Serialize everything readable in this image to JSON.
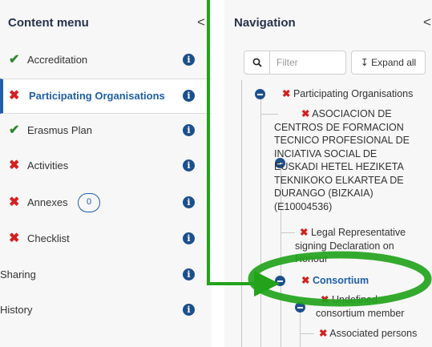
{
  "content_menu": {
    "title": "Content menu",
    "collapse_glyph": "<",
    "items": [
      {
        "label": "Accreditation",
        "status": "complete",
        "status_glyph": "✔",
        "info_glyph": "i"
      },
      {
        "label": "Participating Organisations",
        "status": "error",
        "status_glyph": "✖",
        "info_glyph": "i",
        "active": true
      },
      {
        "label": "Erasmus Plan",
        "status": "complete",
        "status_glyph": "✔",
        "info_glyph": "i"
      },
      {
        "label": "Activities",
        "status": "error",
        "status_glyph": "✖",
        "info_glyph": "i"
      },
      {
        "label": "Annexes",
        "status": "error",
        "status_glyph": "✖",
        "info_glyph": "i",
        "badge": "0"
      },
      {
        "label": "Checklist",
        "status": "error",
        "status_glyph": "✖",
        "info_glyph": "i"
      },
      {
        "label": "Sharing",
        "info_glyph": "i"
      },
      {
        "label": "History",
        "info_glyph": "i"
      }
    ]
  },
  "navigation": {
    "title": "Navigation",
    "collapse_glyph": "<",
    "filter_placeholder": "Filter",
    "expand_all_label": "↧ Expand all",
    "tree": {
      "x_glyph": "✖",
      "participating_organisations": "Participating Organisations",
      "organisation_lines": [
        "ASOCIACION DE",
        "CENTROS DE FORMACION",
        "TECNICO PROFESIONAL DE",
        "INCIATIVA SOCIAL DE",
        "EUSKADI HETEL HEZIKETA",
        "TEKNIKOKO ELKARTEA DE",
        "DURANGO (BIZKAIA)",
        "(E10004536)"
      ],
      "legal_representative_lines": [
        "Legal Representative",
        "signing Declaration on",
        "Honour"
      ],
      "consortium": "Consortium",
      "undefined_member_lines": [
        "Undefined",
        "consortium member"
      ],
      "associated_persons": "Associated persons"
    }
  },
  "colors": {
    "accent_blue": "#1d5fa8",
    "error_red": "#d42020",
    "ok_green": "#2f8a2f",
    "annotation_green": "#22a31b"
  }
}
